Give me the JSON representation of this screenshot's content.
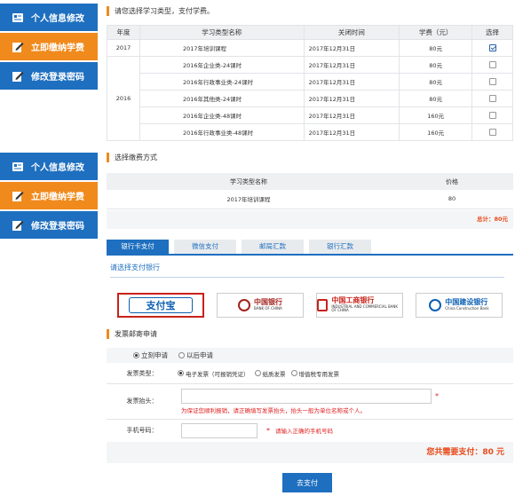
{
  "colors": {
    "blue": "#1e6fbf",
    "orange": "#f08a1c",
    "accent_red": "#e84a1b"
  },
  "sidebar": {
    "items": [
      {
        "label": "个人信息修改",
        "icon": "profile-card-icon",
        "state": "blue"
      },
      {
        "label": "立即缴纳学费",
        "icon": "payment-edit-icon",
        "state": "active-orange"
      },
      {
        "label": "修改登录密码",
        "icon": "password-edit-icon",
        "state": "blue"
      }
    ]
  },
  "course_section": {
    "title": "请您选择学习类型，支付学费。",
    "headers": [
      "年度",
      "学习类型名称",
      "关闭时间",
      "学费（元）",
      "选择"
    ],
    "groups": [
      {
        "year": "2017",
        "rows": [
          {
            "name": "2017年培训课程",
            "close": "2017年12月31日",
            "fee": "80元",
            "checked": true
          }
        ]
      },
      {
        "year": "2016",
        "rows": [
          {
            "name": "2016年企业类-24课时",
            "close": "2017年12月31日",
            "fee": "80元",
            "checked": false
          },
          {
            "name": "2016年行政事业类-24课时",
            "close": "2017年12月31日",
            "fee": "80元",
            "checked": false
          },
          {
            "name": "2016年其他类-24课时",
            "close": "2017年12月31日",
            "fee": "80元",
            "checked": false
          },
          {
            "name": "2016年企业类-48课时",
            "close": "2017年12月31日",
            "fee": "160元",
            "checked": false
          },
          {
            "name": "2016年行政事业类-48课时",
            "close": "2017年12月31日",
            "fee": "160元",
            "checked": false
          }
        ]
      }
    ]
  },
  "payment_section": {
    "title": "选择缴费方式",
    "headers": [
      "学习类型名称",
      "价格"
    ],
    "rows": [
      {
        "name": "2017年培训课程",
        "price": "80"
      }
    ],
    "total": "总计：80元"
  },
  "pay_tabs": [
    {
      "label": "银行卡支付",
      "active": true
    },
    {
      "label": "微信支付",
      "active": false
    },
    {
      "label": "邮局汇款",
      "active": false
    },
    {
      "label": "银行汇款",
      "active": false
    }
  ],
  "bank_select": {
    "label": "请选择支付银行",
    "banks": [
      {
        "name": "支付宝",
        "en": "",
        "icon": "alipay-logo",
        "selected": true
      },
      {
        "name": "中国银行",
        "en": "BANK OF CHINA",
        "icon": "bank-of-china-logo",
        "selected": false
      },
      {
        "name": "中国工商银行",
        "en": "INDUSTRIAL AND COMMERCIAL BANK OF CHINA",
        "icon": "icbc-logo",
        "selected": false
      },
      {
        "name": "中国建设银行",
        "en": "China Construction Bank",
        "icon": "ccb-logo",
        "selected": false
      }
    ]
  },
  "invoice_section": {
    "title": "发票邮寄申请",
    "apply_options": [
      {
        "label": "立刻申请",
        "checked": true
      },
      {
        "label": "以后申请",
        "checked": false
      }
    ],
    "type_label": "发票类型：",
    "type_options": [
      {
        "label": "电子发票（可报销凭证）",
        "checked": true
      },
      {
        "label": "纸质发票",
        "checked": false
      },
      {
        "label": "增值税专用发票",
        "checked": false
      }
    ],
    "title_label": "发票抬头：",
    "title_value": "",
    "title_hint": "为保证您顺利报销，请正确填写发票抬头，抬头一般为单位名称或个人。",
    "phone_label": "手机号码：",
    "phone_value": "",
    "phone_hint": "请输入正确的手机号码",
    "required_mark": "*"
  },
  "total_due": "您共需要支付：80 元",
  "submit_label": "去支付"
}
